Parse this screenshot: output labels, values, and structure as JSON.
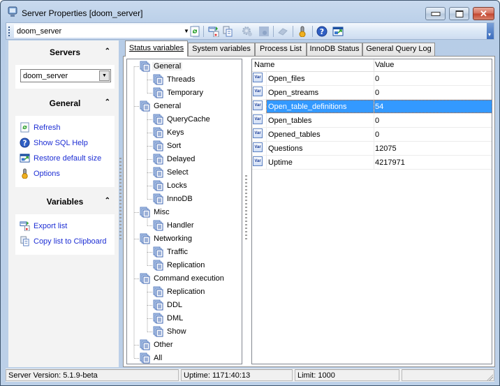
{
  "window": {
    "title": "Server Properties [doom_server]",
    "icon": "server-monitor-icon",
    "controls": [
      "minimize-icon",
      "maximize-icon",
      "close-icon"
    ]
  },
  "toolbar": {
    "server_combo_value": "doom_server",
    "buttons": [
      {
        "name": "refresh",
        "icon": "refresh-icon",
        "enabled": true
      },
      {
        "name": "export-list",
        "icon": "export-icon",
        "enabled": true
      },
      {
        "name": "copy-list",
        "icon": "copy-icon",
        "enabled": true
      },
      {
        "name": "gear",
        "icon": "gear-icon",
        "enabled": false
      },
      {
        "name": "gear-alt",
        "icon": "gear-alt-icon",
        "enabled": false
      },
      {
        "name": "eraser",
        "icon": "eraser-icon",
        "enabled": false
      },
      {
        "name": "options",
        "icon": "options-icon",
        "enabled": true
      },
      {
        "name": "help",
        "icon": "help-icon",
        "enabled": true
      },
      {
        "name": "restore-size",
        "icon": "restore-size-icon",
        "enabled": true
      }
    ]
  },
  "sidebar": {
    "servers": {
      "title": "Servers",
      "selected": "doom_server"
    },
    "general": {
      "title": "General",
      "items": [
        {
          "label": "Refresh",
          "icon": "refresh-icon"
        },
        {
          "label": "Show SQL Help",
          "icon": "help-icon"
        },
        {
          "label": "Restore default size",
          "icon": "restore-size-icon"
        },
        {
          "label": "Options",
          "icon": "options-icon"
        }
      ]
    },
    "variables": {
      "title": "Variables",
      "items": [
        {
          "label": "Export list",
          "icon": "export-icon"
        },
        {
          "label": "Copy list to Clipboard",
          "icon": "copy-icon"
        }
      ]
    }
  },
  "tabs": [
    {
      "label": "Status variables",
      "active": true
    },
    {
      "label": "System variables",
      "active": false
    },
    {
      "label": "Process List",
      "active": false
    },
    {
      "label": "InnoDB Status",
      "active": false
    },
    {
      "label": "General Query Log",
      "active": false
    }
  ],
  "tree": [
    {
      "label": "General",
      "level": 0,
      "selected": true
    },
    {
      "label": "Threads",
      "level": 1
    },
    {
      "label": "Temporary",
      "level": 1
    },
    {
      "label": "General",
      "level": 0
    },
    {
      "label": "QueryCache",
      "level": 1
    },
    {
      "label": "Keys",
      "level": 1
    },
    {
      "label": "Sort",
      "level": 1
    },
    {
      "label": "Delayed",
      "level": 1
    },
    {
      "label": "Select",
      "level": 1
    },
    {
      "label": "Locks",
      "level": 1
    },
    {
      "label": "InnoDB",
      "level": 1
    },
    {
      "label": "Misc",
      "level": 0
    },
    {
      "label": "Handler",
      "level": 1
    },
    {
      "label": "Networking",
      "level": 0
    },
    {
      "label": "Traffic",
      "level": 1
    },
    {
      "label": "Replication",
      "level": 1
    },
    {
      "label": "Command execution",
      "level": 0
    },
    {
      "label": "Replication",
      "level": 1
    },
    {
      "label": "DDL",
      "level": 1
    },
    {
      "label": "DML",
      "level": 1
    },
    {
      "label": "Show",
      "level": 1
    },
    {
      "label": "Other",
      "level": 0
    },
    {
      "label": "All",
      "level": 0
    }
  ],
  "grid": {
    "columns": [
      "Name",
      "Value"
    ],
    "row_icon_text": "Var",
    "rows": [
      {
        "name": "Open_files",
        "value": "0"
      },
      {
        "name": "Open_streams",
        "value": "0"
      },
      {
        "name": "Open_table_definitions",
        "value": "54",
        "selected": true
      },
      {
        "name": "Open_tables",
        "value": "0"
      },
      {
        "name": "Opened_tables",
        "value": "0"
      },
      {
        "name": "Questions",
        "value": "12075"
      },
      {
        "name": "Uptime",
        "value": "4217971"
      }
    ]
  },
  "statusbar": {
    "server_version": "Server Version: 5.1.9-beta",
    "uptime": "Uptime: 1171:40:13",
    "limit": "Limit: 1000",
    "extra": ""
  }
}
